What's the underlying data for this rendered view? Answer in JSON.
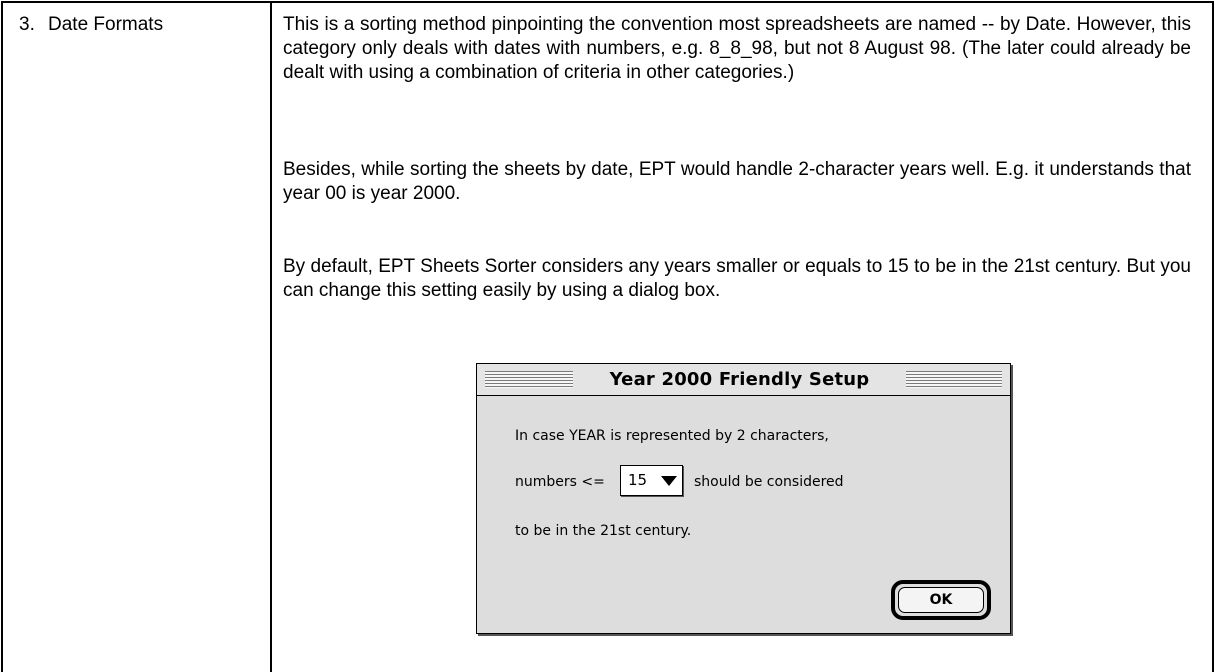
{
  "row": {
    "number": "3.",
    "label": "Date Formats",
    "paragraphs": [
      "This is a sorting method pinpointing the convention most spreadsheets are named -- by Date.  However, this category only deals with dates with numbers, e.g. 8_8_98, but not 8 August 98.  (The later could already be dealt with using a combination of criteria in other categories.)",
      "Besides, while sorting the sheets by date, EPT would handle 2-character years well.  E.g. it understands that year 00 is year 2000.",
      "By default, EPT Sheets Sorter considers any years smaller or equals to 15 to be in the 21st century.  But you can change this setting easily by using a dialog box."
    ]
  },
  "dialog": {
    "title": "Year 2000 Friendly Setup",
    "line1": "In case YEAR is represented by 2 characters,",
    "line2_prefix": "numbers <=",
    "selected_value": "15",
    "line2_suffix": "should be considered",
    "line3": "to be in the 21st century.",
    "ok_label": "OK"
  }
}
